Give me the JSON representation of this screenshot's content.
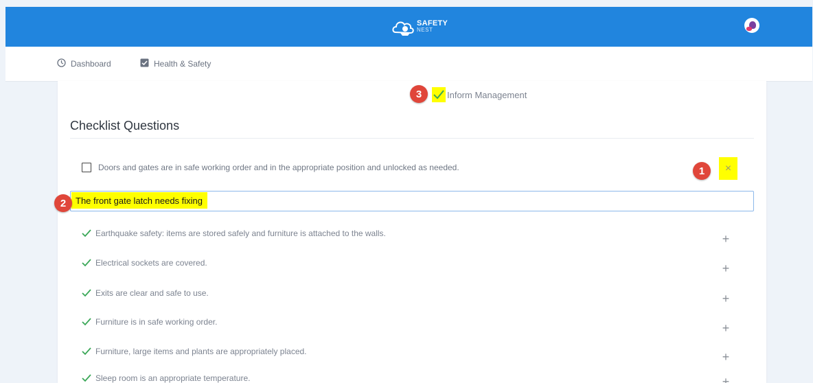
{
  "header": {
    "brand_line1": "SAFETY",
    "brand_line2": "NEST"
  },
  "nav": {
    "items": [
      {
        "label": "Dashboard",
        "icon": "dashboard-icon"
      },
      {
        "label": "Health & Safety",
        "icon": "checkbox-icon"
      }
    ]
  },
  "annotations": {
    "badge1": "1",
    "badge2": "2",
    "badge3": "3",
    "highlight_color": "#ffff00",
    "badge_color": "#e0463a"
  },
  "inform": {
    "label": "Inform Management"
  },
  "checklist": {
    "title": "Checklist Questions",
    "open_question": "Doors and gates are in safe working order and in the appropriate position and unlocked as needed.",
    "remove_symbol": "×",
    "note_value": "The front gate latch needs fixing",
    "completed": [
      "Earthquake safety: items are stored safely and furniture is attached to the walls.",
      "Electrical sockets are covered.",
      "Exits are clear and safe to use.",
      "Furniture is in safe working order.",
      "Furniture, large items and plants are appropriately placed.",
      "Sleep room is an appropriate temperature."
    ],
    "add_symbol": "+"
  },
  "colors": {
    "header_bg": "#2185de",
    "check_green": "#3aa757"
  }
}
